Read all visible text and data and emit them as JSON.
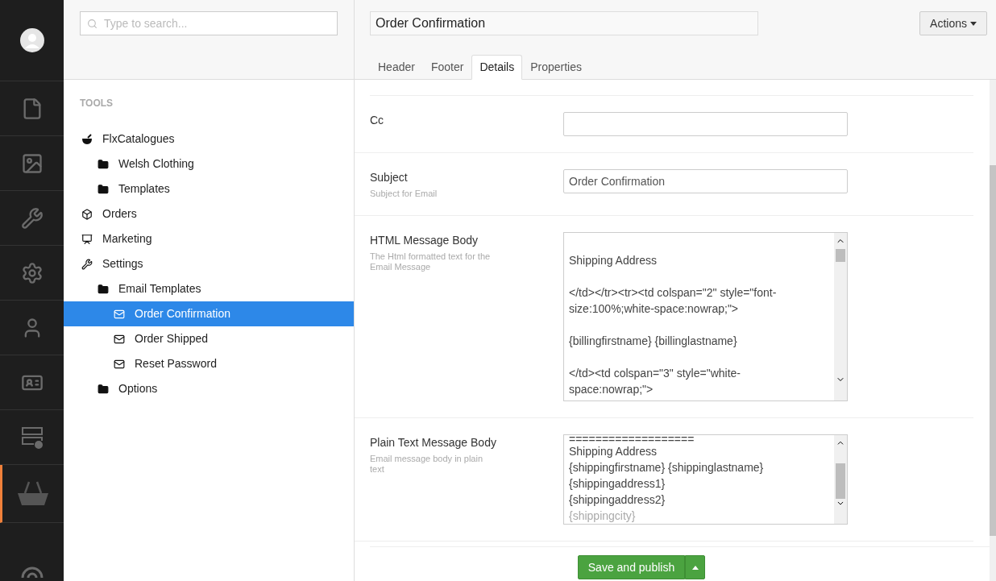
{
  "rail": [
    {
      "kind": "avatar",
      "selected": false
    },
    {
      "kind": "content",
      "selected": false
    },
    {
      "kind": "media",
      "selected": false
    },
    {
      "kind": "developer",
      "selected": false
    },
    {
      "kind": "settings",
      "selected": false
    },
    {
      "kind": "users",
      "selected": false
    },
    {
      "kind": "members",
      "selected": false
    },
    {
      "kind": "forms",
      "selected": false
    },
    {
      "kind": "commerce",
      "selected": true
    },
    {
      "kind": "help",
      "selected": false
    }
  ],
  "search": {
    "placeholder": "Type to search..."
  },
  "tree": {
    "heading": "TOOLS",
    "items": [
      {
        "label": "FlxCatalogues",
        "kind": "bowl",
        "selected": false,
        "children": [
          {
            "label": "Welsh Clothing",
            "kind": "folder",
            "selected": false
          },
          {
            "label": "Templates",
            "kind": "folder",
            "selected": false
          }
        ]
      },
      {
        "label": "Orders",
        "kind": "cube",
        "selected": false
      },
      {
        "label": "Marketing",
        "kind": "board",
        "selected": false
      },
      {
        "label": "Settings",
        "kind": "wrench",
        "selected": false,
        "children": [
          {
            "label": "Email Templates",
            "kind": "folder",
            "selected": false,
            "children": [
              {
                "label": "Order Confirmation",
                "kind": "mail",
                "selected": true
              },
              {
                "label": "Order Shipped",
                "kind": "mail",
                "selected": false
              },
              {
                "label": "Reset Password",
                "kind": "mail",
                "selected": false
              }
            ]
          },
          {
            "label": "Options",
            "kind": "folder",
            "selected": false
          }
        ]
      }
    ]
  },
  "editor": {
    "title": "Order Confirmation",
    "actions": "Actions",
    "tabs": [
      {
        "label": "Header",
        "selected": false
      },
      {
        "label": "Footer",
        "selected": false
      },
      {
        "label": "Details",
        "selected": true
      },
      {
        "label": "Properties",
        "selected": false
      }
    ],
    "fields": [
      {
        "kind": "input",
        "label": "Cc"
      },
      {
        "kind": "input",
        "label": "Subject",
        "description": "Subject for Email",
        "value": "Order Confirmation"
      },
      {
        "kind": "textarea",
        "label": "HTML Message Body",
        "description": "The Html formatted text for the Email Message",
        "lines": [
          "Shipping Address",
          "</td></tr><tr><td colspan=\"2\" style=\"font-size:100%;white-space:nowrap;\">",
          "{billingfirstname} {billinglastname}",
          "</td><td colspan=\"3\" style=\"white-space:nowrap;\">"
        ]
      },
      {
        "kind": "plaintext",
        "label": "Plain Text Message Body",
        "description": "Email message body in plain text",
        "lines": [
          "===================",
          "Shipping Address",
          "{shippingfirstname} {shippinglastname}",
          "{shippingaddress1}",
          "{shippingaddress2}",
          "{shippingcity}"
        ]
      }
    ],
    "save": "Save and publish"
  }
}
